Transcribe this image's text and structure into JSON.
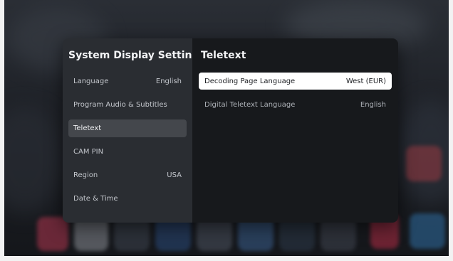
{
  "left": {
    "title": "System Display Settings",
    "items": [
      {
        "label": "Language",
        "value": "English"
      },
      {
        "label": "Program Audio & Subtitles",
        "value": ""
      },
      {
        "label": "Teletext",
        "value": ""
      },
      {
        "label": "CAM PIN",
        "value": ""
      },
      {
        "label": "Region",
        "value": "USA"
      },
      {
        "label": "Date & Time",
        "value": ""
      }
    ],
    "selected": "Teletext"
  },
  "right": {
    "title": "Teletext",
    "rows": [
      {
        "label": "Decoding Page Language",
        "value": "West (EUR)"
      },
      {
        "label": "Digital Teletext Language",
        "value": "English"
      }
    ],
    "focused": "Decoding Page Language"
  }
}
